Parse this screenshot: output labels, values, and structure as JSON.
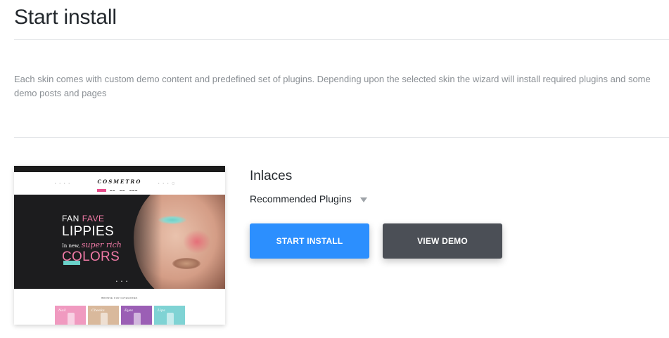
{
  "header": {
    "title": "Start install"
  },
  "intro": {
    "description": "Each skin comes with custom demo content and predefined set of plugins. Depending upon the selected skin the wizard will install required plugins and some demo posts and pages"
  },
  "skin": {
    "name": "Inlaces",
    "plugins_label": "Recommended Plugins",
    "plugins_toggle_icon": "caret-down-icon",
    "buttons": {
      "install_label": "START INSTALL",
      "demo_label": "VIEW DEMO"
    },
    "colors": {
      "install": "#2c8ffe",
      "demo": "#4b4f56"
    },
    "preview": {
      "logo": "COSMETRO",
      "hero_line1_a": "FAN",
      "hero_line1_b": "FAVE",
      "hero_line2": "LIPPIES",
      "hero_line3_a": "In new,",
      "hero_line3_b": "super rich",
      "hero_line4": "COLORS",
      "categories_title": "BROWSE OUR CATEGORIES",
      "categories": [
        "Nail",
        "Cheeks",
        "Eyes",
        "Lips"
      ]
    }
  }
}
